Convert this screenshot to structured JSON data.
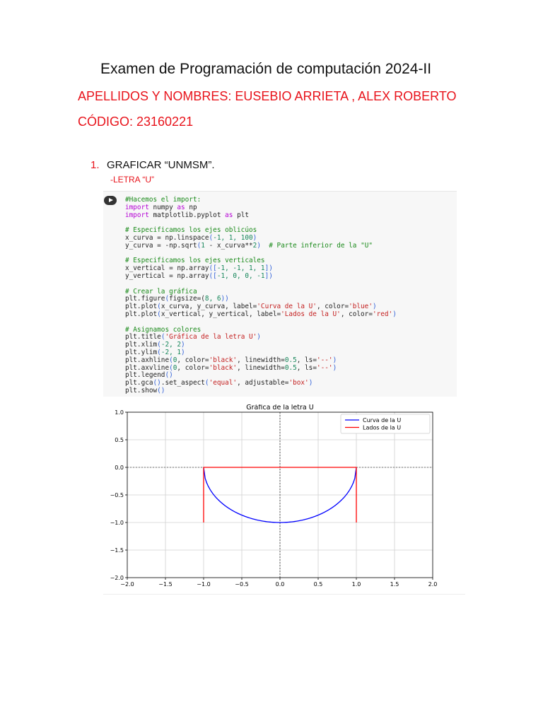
{
  "header": {
    "title": "Examen de Programación de computación 2024-II",
    "names": "APELLIDOS Y NOMBRES: EUSEBIO ARRIETA , ALEX ROBERTO",
    "code": "CÓDIGO: 23160221"
  },
  "question": {
    "number": "1.",
    "text": "GRAFICAR “UNMSM”.",
    "sub": "-LETRA “U”"
  },
  "code_cell": {
    "lines": [
      [
        [
          "#Hacemos el import:",
          "cm"
        ]
      ],
      [
        [
          "import",
          "kw"
        ],
        [
          " numpy ",
          ""
        ],
        [
          "as",
          "kw"
        ],
        [
          " np",
          ""
        ]
      ],
      [
        [
          "import",
          "kw"
        ],
        [
          " matplotlib.pyplot ",
          ""
        ],
        [
          "as",
          "kw"
        ],
        [
          " plt",
          ""
        ]
      ],
      [],
      [
        [
          "# Especificamos los ejes oblicúos",
          "cm"
        ]
      ],
      [
        [
          "x_curva = np.linspace",
          ""
        ],
        [
          "(",
          "br"
        ],
        [
          "-1, 1, 100",
          "num"
        ],
        [
          ")",
          "br"
        ]
      ],
      [
        [
          "y_curva = -np.sqrt",
          ""
        ],
        [
          "(",
          "br"
        ],
        [
          "1",
          "num"
        ],
        [
          " - x_curva**",
          ""
        ],
        [
          "2",
          "num"
        ],
        [
          ")",
          "br"
        ],
        [
          "  # Parte inferior de la \"U\"",
          "cm"
        ]
      ],
      [],
      [
        [
          "# Especificamos los ejes verticales",
          "cm"
        ]
      ],
      [
        [
          "x_vertical = np.array",
          ""
        ],
        [
          "([",
          "br"
        ],
        [
          "-1, -1, 1, 1",
          "num"
        ],
        [
          "])",
          "br"
        ]
      ],
      [
        [
          "y_vertical = np.array",
          ""
        ],
        [
          "([",
          "br"
        ],
        [
          "-1, 0, 0, -1",
          "num"
        ],
        [
          "])",
          "br"
        ]
      ],
      [],
      [
        [
          "# Crear la gráfica",
          "cm"
        ]
      ],
      [
        [
          "plt.figure",
          ""
        ],
        [
          "(",
          "br"
        ],
        [
          "figsize=(",
          ""
        ],
        [
          "8, 6",
          "num"
        ],
        [
          "))",
          "br"
        ]
      ],
      [
        [
          "plt.plot",
          ""
        ],
        [
          "(",
          "br"
        ],
        [
          "x_curva, y_curva, label=",
          ""
        ],
        [
          "'Curva de la U'",
          "str"
        ],
        [
          ", color=",
          ""
        ],
        [
          "'blue'",
          "str"
        ],
        [
          ")",
          "br"
        ]
      ],
      [
        [
          "plt.plot",
          ""
        ],
        [
          "(",
          "br"
        ],
        [
          "x_vertical, y_vertical, label=",
          ""
        ],
        [
          "'Lados de la U'",
          "str"
        ],
        [
          ", color=",
          ""
        ],
        [
          "'red'",
          "str"
        ],
        [
          ")",
          "br"
        ]
      ],
      [],
      [
        [
          "# Asignamos colores",
          "cm"
        ]
      ],
      [
        [
          "plt.title",
          ""
        ],
        [
          "(",
          "br"
        ],
        [
          "'Gráfica de la letra U'",
          "str"
        ],
        [
          ")",
          "br"
        ]
      ],
      [
        [
          "plt.xlim",
          ""
        ],
        [
          "(",
          "br"
        ],
        [
          "-2, 2",
          "num"
        ],
        [
          ")",
          "br"
        ]
      ],
      [
        [
          "plt.ylim",
          ""
        ],
        [
          "(",
          "br"
        ],
        [
          "-2, 1",
          "num"
        ],
        [
          ")",
          "br"
        ]
      ],
      [
        [
          "plt.axhline",
          ""
        ],
        [
          "(",
          "br"
        ],
        [
          "0",
          "num"
        ],
        [
          ", color=",
          ""
        ],
        [
          "'black'",
          "str"
        ],
        [
          ", linewidth=",
          ""
        ],
        [
          "0.5",
          "num"
        ],
        [
          ", ls=",
          ""
        ],
        [
          "'--'",
          "str"
        ],
        [
          ")",
          "br"
        ]
      ],
      [
        [
          "plt.axvline",
          ""
        ],
        [
          "(",
          "br"
        ],
        [
          "0",
          "num"
        ],
        [
          ", color=",
          ""
        ],
        [
          "'black'",
          "str"
        ],
        [
          ", linewidth=",
          ""
        ],
        [
          "0.5",
          "num"
        ],
        [
          ", ls=",
          ""
        ],
        [
          "'--'",
          "str"
        ],
        [
          ")",
          "br"
        ]
      ],
      [
        [
          "plt.legend",
          ""
        ],
        [
          "()",
          "br"
        ]
      ],
      [
        [
          "plt.gca",
          ""
        ],
        [
          "()",
          "br"
        ],
        [
          ".set_aspect",
          ""
        ],
        [
          "(",
          "br"
        ],
        [
          "'equal'",
          "str"
        ],
        [
          ", adjustable=",
          ""
        ],
        [
          "'box'",
          "str"
        ],
        [
          ")",
          "br"
        ]
      ],
      [
        [
          "plt.show",
          ""
        ],
        [
          "()",
          "br"
        ]
      ]
    ]
  },
  "chart_data": {
    "type": "line",
    "title": "Gráfica de la letra U",
    "xlim": [
      -2,
      2
    ],
    "ylim": [
      -2,
      1
    ],
    "grid": true,
    "legend": "top-right",
    "xticks": [
      "−2.0",
      "−1.5",
      "−1.0",
      "−0.5",
      "0.0",
      "0.5",
      "1.0",
      "1.5",
      "2.0"
    ],
    "yticks": [
      "1.0",
      "0.5",
      "0.0",
      "−0.5",
      "−1.0",
      "−1.5",
      "−2.0"
    ],
    "series": [
      {
        "name": "Curva de la U",
        "color": "#0000ff",
        "function": "y=-sqrt(1-x^2)",
        "x_range": [
          -1,
          1
        ],
        "points": 100
      },
      {
        "name": "Lados de la U",
        "color": "#ff0000",
        "x": [
          -1,
          -1,
          1,
          1
        ],
        "y": [
          -1,
          0,
          0,
          -1
        ]
      }
    ]
  }
}
